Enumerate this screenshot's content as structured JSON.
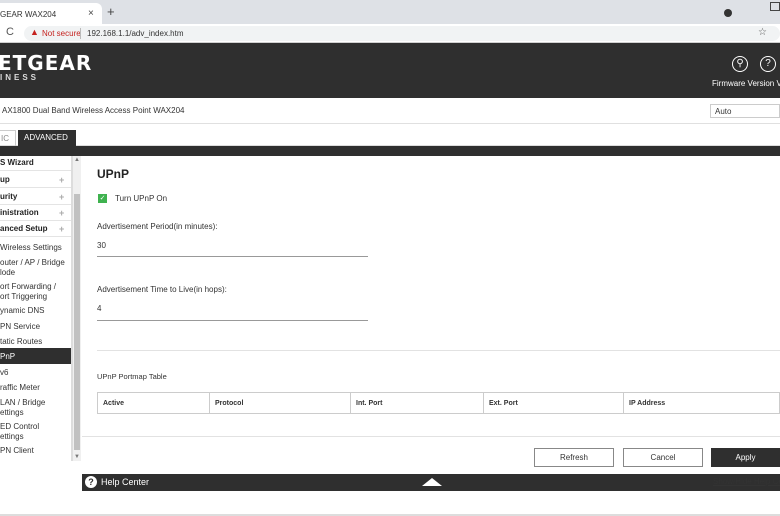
{
  "browser": {
    "tab_title": "GEAR WAX204",
    "tab_close": "×",
    "new_tab": "+",
    "reload_icon": "C",
    "security_warning": "Not secure",
    "url": "192.168.1.1/adv_index.htm"
  },
  "header": {
    "logo": "ETGEAR",
    "logo_sub": "INESS",
    "search_icon": "⚲",
    "help_icon": "?",
    "firmware": "Firmware Version V"
  },
  "device": {
    "name": "AX1800 Dual Band Wireless Access Point WAX204",
    "language": "Auto"
  },
  "tabs": {
    "basic": "IC",
    "advanced": "ADVANCED"
  },
  "sidebar": {
    "items": [
      {
        "label": "S Wizard"
      },
      {
        "label": "up"
      },
      {
        "label": "urity"
      },
      {
        "label": "inistration"
      },
      {
        "label": "anced Setup"
      },
      {
        "label": "Wireless Settings"
      },
      {
        "label": "outer / AP / Bridge"
      },
      {
        "label": "lode"
      },
      {
        "label": "ort Forwarding /"
      },
      {
        "label": "ort Triggering"
      },
      {
        "label": "ynamic DNS"
      },
      {
        "label": "PN Service"
      },
      {
        "label": "tatic Routes"
      },
      {
        "label": "PnP"
      },
      {
        "label": "v6"
      },
      {
        "label": "raffic Meter"
      },
      {
        "label": "LAN / Bridge"
      },
      {
        "label": "ettings"
      },
      {
        "label": "ED Control"
      },
      {
        "label": "ettings"
      },
      {
        "label": "PN Client"
      }
    ]
  },
  "main": {
    "title": "UPnP",
    "turn_on_label": "Turn UPnP On",
    "turn_on_checked": true,
    "adv_period_label": "Advertisement Period(in minutes):",
    "adv_period_value": "30",
    "adv_ttl_label": "Advertisement Time to Live(in hops):",
    "adv_ttl_value": "4",
    "table_title": "UPnP Portmap Table",
    "columns": [
      "Active",
      "Protocol",
      "Int. Port",
      "Ext. Port",
      "IP Address"
    ]
  },
  "buttons": {
    "refresh": "Refresh",
    "cancel": "Cancel",
    "apply": "Apply"
  },
  "help": {
    "label": "Help Center",
    "toggle": "Show/Hide Help Ce"
  },
  "colors": {
    "header_bg": "#2f2f2f",
    "checkbox": "#3fb24f",
    "warning": "#c5221f"
  }
}
